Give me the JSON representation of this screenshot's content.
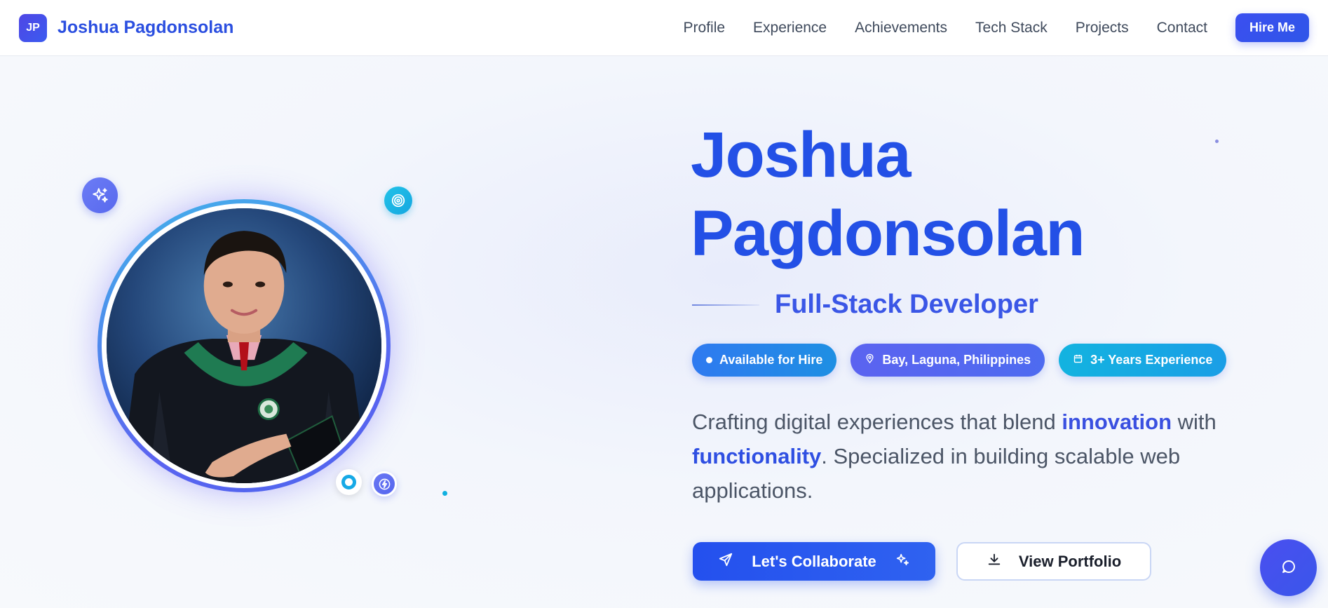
{
  "navbar": {
    "logo_initials": "JP",
    "brand_name": "Joshua Pagdonsolan",
    "links": [
      {
        "label": "Profile"
      },
      {
        "label": "Experience"
      },
      {
        "label": "Achievements"
      },
      {
        "label": "Tech Stack"
      },
      {
        "label": "Projects"
      },
      {
        "label": "Contact"
      }
    ],
    "hire_button": "Hire Me"
  },
  "hero": {
    "name_line1": "Joshua",
    "name_line2": "Pagdonsolan",
    "role": "Full-Stack Developer",
    "badges": [
      {
        "label": "Available for Hire",
        "icon": "status-dot-icon"
      },
      {
        "label": "Bay, Laguna, Philippines",
        "icon": "map-pin-icon"
      },
      {
        "label": "3+ Years Experience",
        "icon": "calendar-icon"
      }
    ],
    "tagline": {
      "part1": "Crafting digital experiences that blend ",
      "highlight1": "innovation",
      "part2": " with ",
      "highlight2": "functionality",
      "part3": ". Specialized in building scalable web applications."
    },
    "cta_primary": "Let's Collaborate",
    "cta_secondary": "View Portfolio"
  },
  "icons": {
    "floating": [
      "sparkle-icon",
      "target-icon",
      "ring-icon",
      "bolt-icon"
    ],
    "chat": "chat-bubble-icon"
  },
  "colors": {
    "accent": "#2350e6",
    "brand_blue": "#3a56e6",
    "cyan": "#13b3e0",
    "violet": "#5b63f0"
  }
}
